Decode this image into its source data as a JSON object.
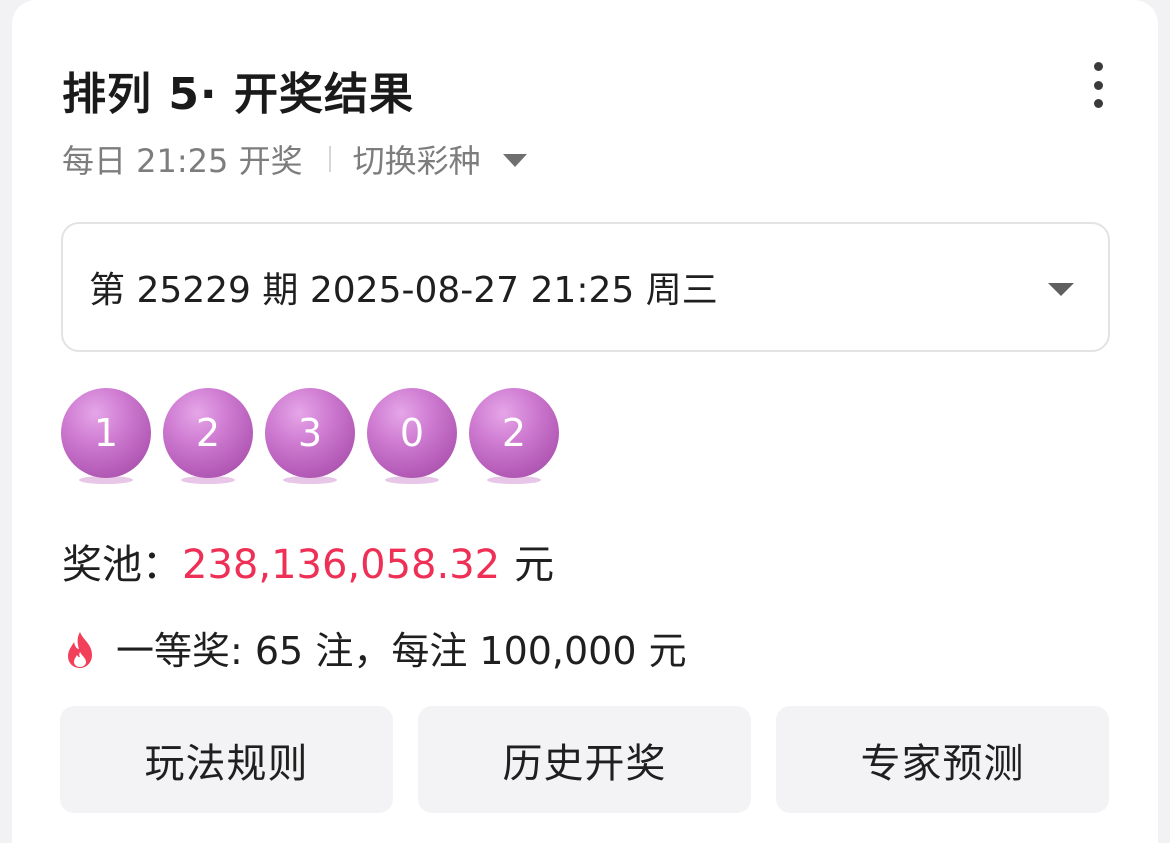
{
  "header": {
    "title": "排列 5· 开奖结果",
    "more_icon": "more-vertical-icon"
  },
  "schedule": {
    "draw_time": "每日 21:25 开奖",
    "switch_label": "切换彩种",
    "switch_icon": "caret-down-icon"
  },
  "period_select": {
    "value": "第 25229 期 2025-08-27 21:25 周三",
    "icon": "caret-down-icon"
  },
  "numbers": [
    "1",
    "2",
    "3",
    "0",
    "2"
  ],
  "pool": {
    "label": "奖池：",
    "amount": "238,136,058.32",
    "unit": "元",
    "amount_color": "#ef3056"
  },
  "first_prize": {
    "icon": "flame-icon",
    "text": "一等奖: 65 注，每注 100,000 元"
  },
  "actions": [
    {
      "label": "玩法规则"
    },
    {
      "label": "历史开奖"
    },
    {
      "label": "专家预测"
    }
  ],
  "colors": {
    "ball": "#c46fc8",
    "accent": "#ef3056"
  }
}
